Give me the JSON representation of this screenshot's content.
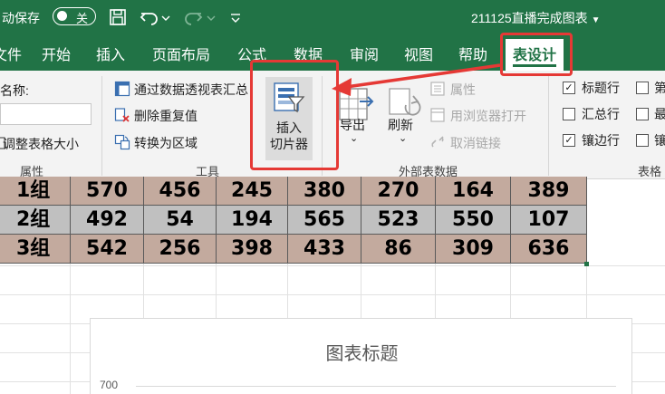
{
  "titlebar": {
    "autosave_label": "自动保存",
    "autosave_state": "关",
    "file_title": "211125直播完成图表"
  },
  "tabs": [
    {
      "label": "文件"
    },
    {
      "label": "开始"
    },
    {
      "label": "插入"
    },
    {
      "label": "页面布局"
    },
    {
      "label": "公式"
    },
    {
      "label": "数据"
    },
    {
      "label": "审阅"
    },
    {
      "label": "视图"
    },
    {
      "label": "帮助"
    },
    {
      "label": "表设计"
    }
  ],
  "ribbon": {
    "properties": {
      "name_label": "表名称:",
      "resize_label": "调整表格大小",
      "group_label": "属性"
    },
    "tools": {
      "pivot_label": "通过数据透视表汇总",
      "dedupe_label": "删除重复值",
      "convert_label": "转换为区域",
      "slicer_line1": "插入",
      "slicer_line2": "切片器",
      "group_label": "工具"
    },
    "external": {
      "export_label": "导出",
      "refresh_label": "刷新",
      "props_label": "属性",
      "browser_label": "用浏览器打开",
      "unlink_label": "取消链接",
      "group_label": "外部表数据"
    },
    "style_options": {
      "header_row": {
        "label": "标题行",
        "checked": true
      },
      "total_row": {
        "label": "汇总行",
        "checked": false
      },
      "banded_rows": {
        "label": "镶边行",
        "checked": true
      },
      "first_col": {
        "label": "第",
        "checked": false
      },
      "last_col": {
        "label": "最",
        "checked": false
      },
      "banded_cols": {
        "label": "镶",
        "checked": false
      },
      "group_label": "表格"
    }
  },
  "table": {
    "colors": {
      "band_a": "#c3aa9e",
      "band_b": "#c0c0c0"
    },
    "rows": [
      [
        "1组",
        "570",
        "456",
        "245",
        "380",
        "270",
        "164",
        "389"
      ],
      [
        "2组",
        "492",
        "54",
        "194",
        "565",
        "523",
        "550",
        "107"
      ],
      [
        "3组",
        "542",
        "256",
        "398",
        "433",
        "86",
        "309",
        "636"
      ]
    ]
  },
  "chart": {
    "title": "图表标题",
    "y_top_tick": "700"
  },
  "accent": "#217346",
  "highlight_color": "#e53935"
}
